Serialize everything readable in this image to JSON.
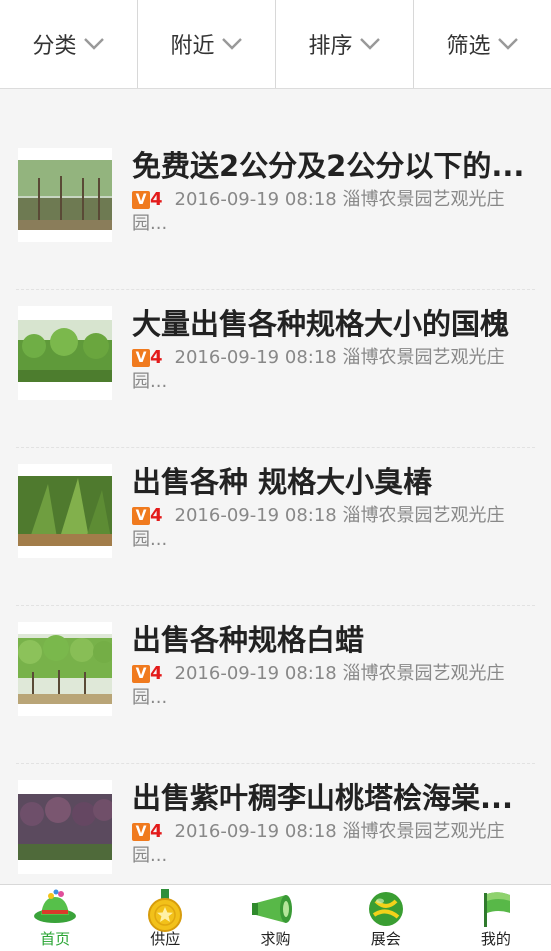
{
  "filters": [
    {
      "label": "分类"
    },
    {
      "label": "附近"
    },
    {
      "label": "排序"
    },
    {
      "label": "筛选"
    }
  ],
  "items": [
    {
      "title": "免费送2公分及2公分以下的...",
      "level": "4",
      "badge": "V",
      "date": "2016-09-19 08:18",
      "seller": "淄博农景园艺观光庄园..."
    },
    {
      "title": "大量出售各种规格大小的国槐",
      "level": "4",
      "badge": "V",
      "date": "2016-09-19 08:18",
      "seller": "淄博农景园艺观光庄园..."
    },
    {
      "title": "出售各种 规格大小臭椿",
      "level": "4",
      "badge": "V",
      "date": "2016-09-19 08:18",
      "seller": "淄博农景园艺观光庄园..."
    },
    {
      "title": "出售各种规格白蜡",
      "level": "4",
      "badge": "V",
      "date": "2016-09-19 08:18",
      "seller": "淄博农景园艺观光庄园..."
    },
    {
      "title": "出售紫叶稠李山桃塔桧海棠...",
      "level": "4",
      "badge": "V",
      "date": "2016-09-19 08:18",
      "seller": "淄博农景园艺观光庄园..."
    }
  ],
  "nav": [
    {
      "label": "首页",
      "icon": "home-hat-icon",
      "active": true
    },
    {
      "label": "供应",
      "icon": "medal-icon"
    },
    {
      "label": "求购",
      "icon": "megaphone-icon"
    },
    {
      "label": "展会",
      "icon": "ball-icon"
    },
    {
      "label": "我的",
      "icon": "flag-icon"
    }
  ],
  "colors": {
    "accent": "#2aa534",
    "badge": "#f07a1e",
    "level": "#e31b1b"
  }
}
